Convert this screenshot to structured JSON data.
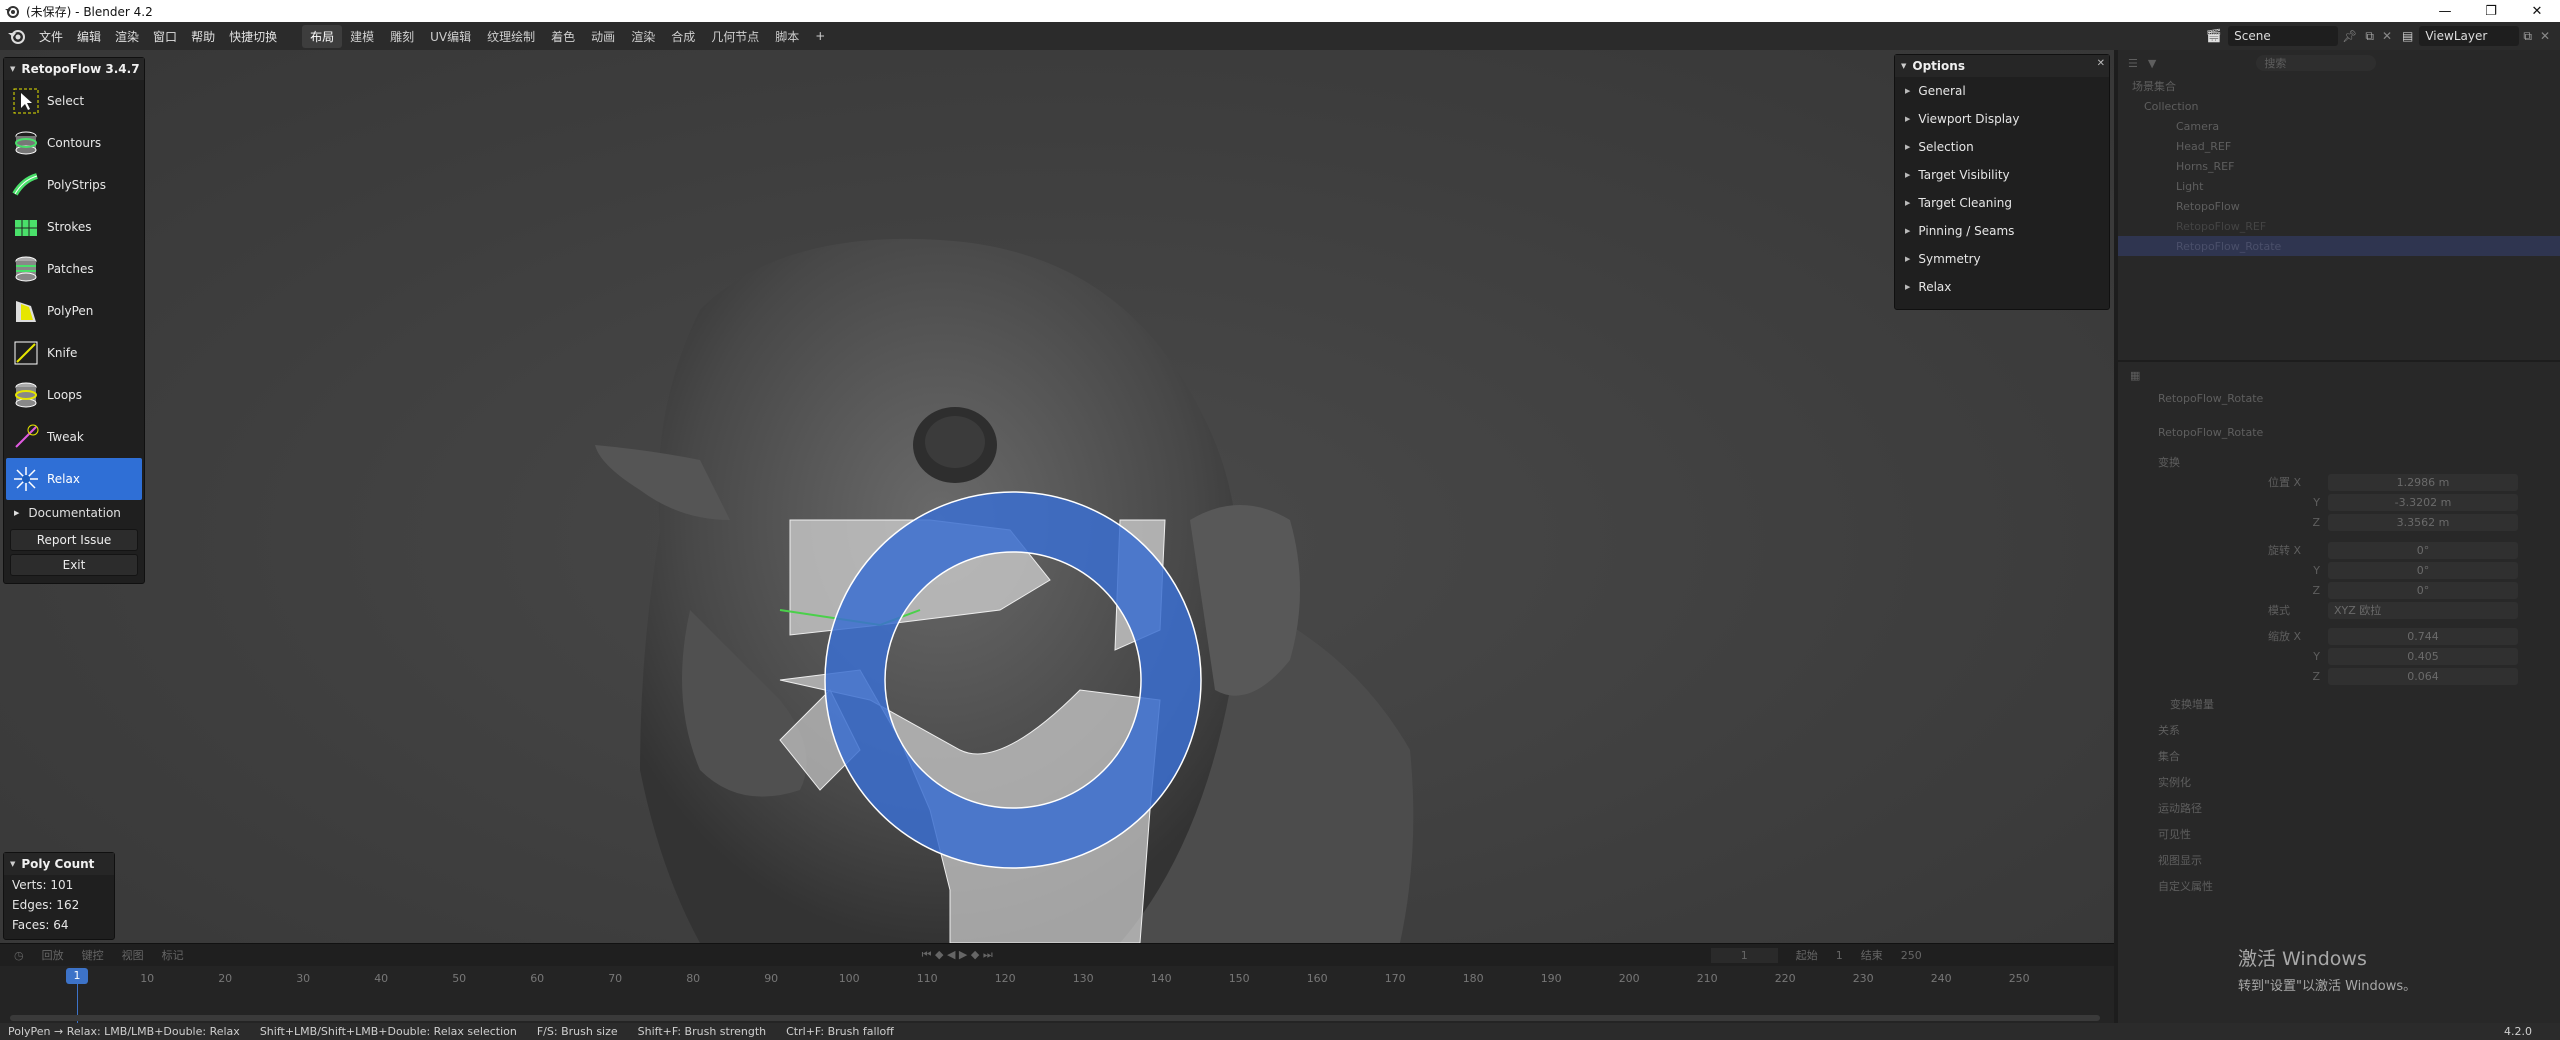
{
  "window": {
    "title": "(未保存) - Blender 4.2",
    "controls": [
      "—",
      "❐",
      "✕"
    ]
  },
  "menubar": {
    "menus": [
      "文件",
      "编辑",
      "渲染",
      "窗口",
      "帮助",
      "快捷切换"
    ],
    "workspaces": [
      "布局",
      "建模",
      "雕刻",
      "UV编辑",
      "纹理绘制",
      "着色",
      "动画",
      "渲染",
      "合成",
      "几何节点",
      "脚本"
    ],
    "add_workspace": "+",
    "scene": "Scene",
    "view_layer": "ViewLayer"
  },
  "retopoflow": {
    "title": "RetopoFlow 3.4.7",
    "tools": [
      {
        "label": "Select",
        "icon": "select-icon"
      },
      {
        "label": "Contours",
        "icon": "contours-icon"
      },
      {
        "label": "PolyStrips",
        "icon": "polystrips-icon"
      },
      {
        "label": "Strokes",
        "icon": "strokes-icon"
      },
      {
        "label": "Patches",
        "icon": "patches-icon"
      },
      {
        "label": "PolyPen",
        "icon": "polypen-icon"
      },
      {
        "label": "Knife",
        "icon": "knife-icon"
      },
      {
        "label": "Loops",
        "icon": "loops-icon"
      },
      {
        "label": "Tweak",
        "icon": "tweak-icon"
      },
      {
        "label": "Relax",
        "icon": "relax-icon"
      }
    ],
    "active_tool": "Relax",
    "documentation": "Documentation",
    "report_issue": "Report Issue",
    "exit": "Exit"
  },
  "options": {
    "title": "Options",
    "items": [
      "General",
      "Viewport Display",
      "Selection",
      "Target Visibility",
      "Target Cleaning",
      "Pinning / Seams",
      "Symmetry",
      "Relax"
    ]
  },
  "poly_count": {
    "title": "Poly Count",
    "verts": "Verts:   101",
    "edges": "Edges:  162",
    "faces": "Faces:   64"
  },
  "timeline": {
    "header": [
      "回放",
      "键控",
      "视图",
      "标记"
    ],
    "current_frame": "1",
    "ticks": [
      "10",
      "20",
      "30",
      "40",
      "50",
      "60",
      "70",
      "80",
      "90",
      "100",
      "110",
      "120",
      "130",
      "140",
      "150",
      "160",
      "170",
      "180",
      "190",
      "200",
      "210",
      "220",
      "230",
      "240",
      "250"
    ],
    "frame_field": "1",
    "start_label": "起始",
    "start": "1",
    "end_label": "结束",
    "end": "250"
  },
  "statusbar": {
    "items": [
      "PolyPen → Relax: LMB/LMB+Double: Relax",
      "Shift+LMB/Shift+LMB+Double: Relax selection",
      "F/S: Brush size",
      "Shift+F: Brush strength",
      "Ctrl+F: Brush falloff"
    ],
    "version": "4.2.0"
  },
  "outliner": {
    "search_placeholder": "搜索",
    "scene_collection": "场景集合",
    "collection": "Collection",
    "items": [
      "Camera",
      "Head_REF",
      "Horns_REF",
      "Light",
      "RetopoFlow",
      "RetopoFlow_REF",
      "RetopoFlow_Rotate"
    ]
  },
  "properties": {
    "object_name": "RetopoFlow_Rotate",
    "data_name": "RetopoFlow_Rotate",
    "transform": "变换",
    "location_label": "位置 X",
    "location": [
      "1.2986 m",
      "-3.3202 m",
      "3.3562 m"
    ],
    "rotation_label": "旋转 X",
    "rotation": [
      "0°",
      "0°",
      "0°"
    ],
    "mode_label": "模式",
    "mode": "XYZ 欧拉",
    "scale_label": "缩放 X",
    "scale": [
      "0.744",
      "0.405",
      "0.064"
    ],
    "axes": [
      "Y",
      "Z"
    ],
    "sections": [
      "变换增量",
      "关系",
      "集合",
      "实例化",
      "运动路径",
      "可见性",
      "视图显示",
      "自定义属性"
    ]
  },
  "watermark": {
    "title": "激活 Windows",
    "subtitle": "转到\"设置\"以激活 Windows。"
  },
  "colors": {
    "accent": "#2f6fd6",
    "brush_ring": "#3b6fd0",
    "mesh": "#c9c9c9"
  }
}
